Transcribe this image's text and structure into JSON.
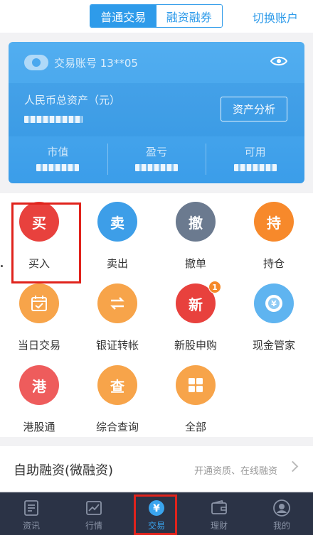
{
  "header": {
    "tabs": [
      {
        "label": "普通交易",
        "active": true
      },
      {
        "label": "融资融券",
        "active": false
      }
    ],
    "switch_account": "切换账户"
  },
  "account": {
    "label": "交易账号 13**05",
    "total_assets_label": "人民币总资产（元）",
    "analysis_button": "资产分析",
    "stats": [
      {
        "label": "市值"
      },
      {
        "label": "盈亏"
      },
      {
        "label": "可用"
      }
    ]
  },
  "functions": [
    {
      "label": "买入",
      "glyph": "买",
      "color": "#e8413d"
    },
    {
      "label": "卖出",
      "glyph": "卖",
      "color": "#3d9ee8"
    },
    {
      "label": "撤单",
      "glyph": "撤",
      "color": "#6b7a8f"
    },
    {
      "label": "持仓",
      "glyph": "持",
      "color": "#f7892b"
    },
    {
      "label": "当日交易",
      "glyph": "calendar-icon",
      "color": "#f7a44a"
    },
    {
      "label": "银证转帐",
      "glyph": "transfer-icon",
      "color": "#f7a44a"
    },
    {
      "label": "新股申购",
      "glyph": "新",
      "color": "#e8413d",
      "badge": "1"
    },
    {
      "label": "现金管家",
      "glyph": "cash-icon",
      "color": "#5fb4f0"
    },
    {
      "label": "港股通",
      "glyph": "港",
      "color": "#ee5c5c"
    },
    {
      "label": "综合查询",
      "glyph": "查",
      "color": "#f7a44a"
    },
    {
      "label": "全部",
      "glyph": "grid-icon",
      "color": "#f7a44a"
    }
  ],
  "finance": {
    "title": "自助融资(微融资)",
    "subtitle": "开通资质、在线融资"
  },
  "tabbar": [
    {
      "label": "资讯",
      "icon": "news-icon",
      "active": false
    },
    {
      "label": "行情",
      "icon": "chart-icon",
      "active": false
    },
    {
      "label": "交易",
      "icon": "yen-icon",
      "active": true
    },
    {
      "label": "理财",
      "icon": "wallet-icon",
      "active": false
    },
    {
      "label": "我的",
      "icon": "profile-icon",
      "active": false
    }
  ]
}
